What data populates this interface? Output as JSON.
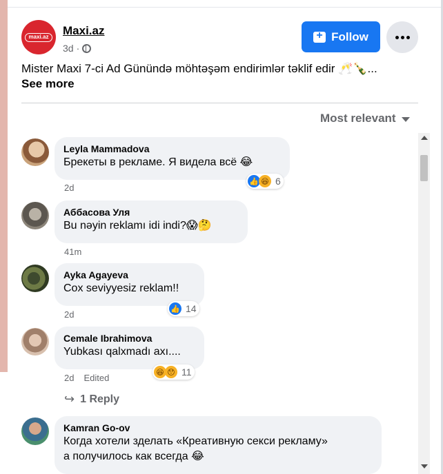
{
  "post": {
    "page_name": "Maxi.az",
    "logo_text": "maxi.az",
    "time": "3d",
    "separator": "·",
    "follow_label": "Follow",
    "text": "Mister Maxi 7-ci Ad Günündə möhtəşəm endirimlər təklif edir 🥂🍾...",
    "see_more": "See more"
  },
  "comments_header": {
    "sort_label": "Most relevant"
  },
  "comments": [
    {
      "name": "Leyla Mammadova",
      "text": "Брекеты в рекламе. Я видела всё 😂",
      "time": "2d",
      "reaction_count": "6"
    },
    {
      "name": "Аббасова Уля",
      "text": "Bu nəyin reklamı idi indi?😱🤔",
      "time": "41m"
    },
    {
      "name": "Ayka Agayeva",
      "text": "Cox seviyyesiz reklam!!",
      "time": "2d",
      "reaction_count": "14"
    },
    {
      "name": "Cemale Ibrahimova",
      "text": "Yubkası qalxmadı axı....",
      "time": "2d",
      "edited": "Edited",
      "reaction_count": "11",
      "reply_label": "1 Reply"
    },
    {
      "name": "Kamran Go-ov",
      "text_line1": "Когда хотели зделать «Креативную секси рекламу»",
      "text_line2": "а получилось как всегда 😂"
    }
  ],
  "colors": {
    "accent": "#1877f2",
    "bubble": "#f0f2f5",
    "secondary_text": "#65676b",
    "logo_red": "#d9262e"
  },
  "icons": {
    "globe": "globe-icon",
    "more": "more-horizontal-icon",
    "sort": "caret-down-icon",
    "reply": "reply-arrow-icon",
    "like": "like-reaction-icon",
    "haha": "haha-reaction-icon"
  }
}
